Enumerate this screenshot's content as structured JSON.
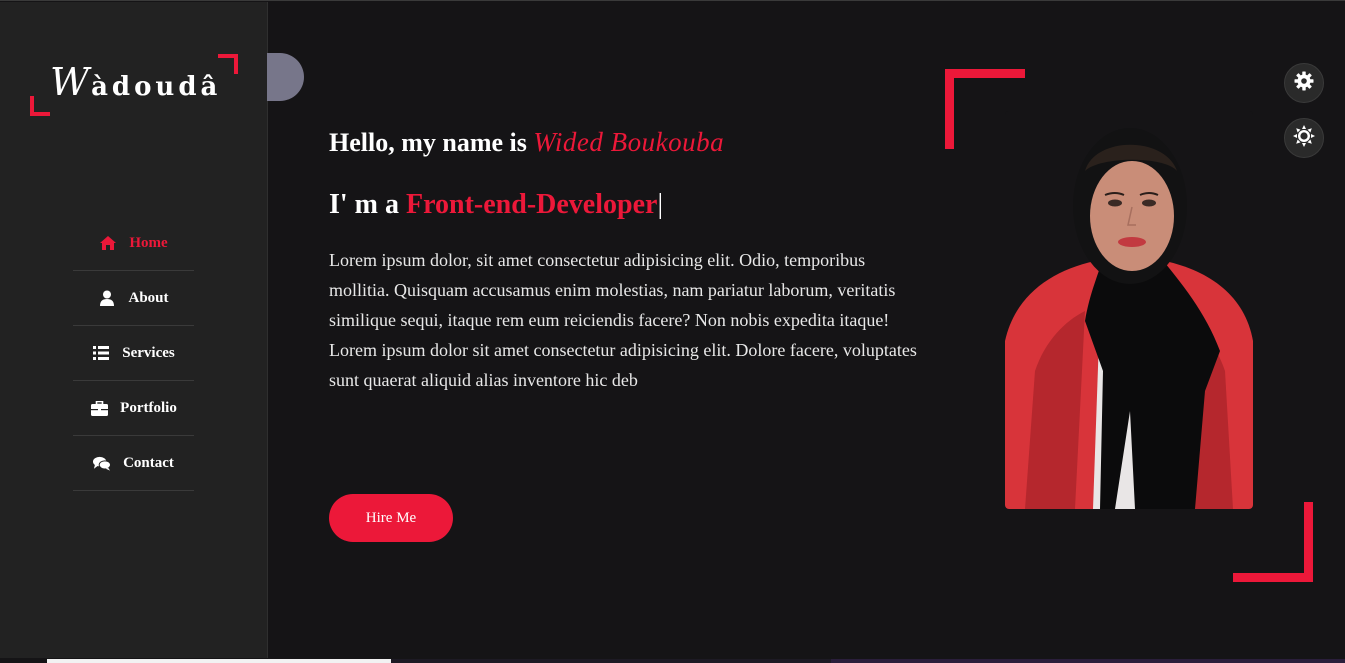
{
  "logo": {
    "first_letter": "W",
    "rest": "àdoudâ"
  },
  "nav": [
    {
      "label": "Home",
      "icon": "home-icon",
      "active": true
    },
    {
      "label": "About",
      "icon": "user-icon",
      "active": false
    },
    {
      "label": "Services",
      "icon": "list-icon",
      "active": false
    },
    {
      "label": "Portfolio",
      "icon": "briefcase-icon",
      "active": false
    },
    {
      "label": "Contact",
      "icon": "comments-icon",
      "active": false
    }
  ],
  "hero": {
    "hello_prefix": "Hello, my name is ",
    "name": "Wided Boukouba",
    "role_prefix": "I' m a ",
    "role": "Front-end-Developer",
    "caret": "|",
    "description": "Lorem ipsum dolor, sit amet consectetur adipisicing elit. Odio, temporibus mollitia. Quisquam accusamus enim molestias, nam pariatur laborum, veritatis similique sequi, itaque rem eum reiciendis facere? Non nobis expedita itaque! Lorem ipsum dolor sit amet consectetur adipisicing elit. Dolore facere, voluptates sunt quaerat aliquid alias inventore hic deb",
    "button": "Hire Me"
  },
  "colors": {
    "accent": "#ec1839",
    "background": "#151416",
    "sidebar": "#222222",
    "deco_circle": "#77768a"
  },
  "switcher": {
    "gear_icon": "gear-icon",
    "theme_icon": "sun-icon"
  }
}
